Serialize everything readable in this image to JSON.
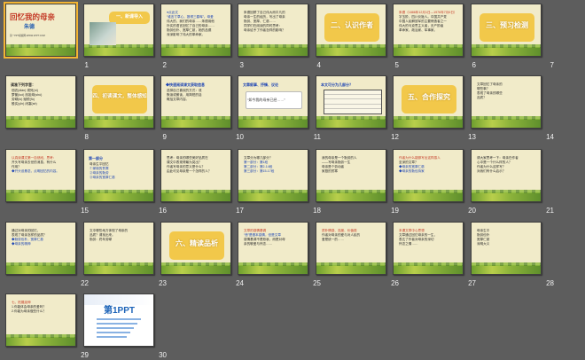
{
  "slides": [
    {
      "n": "1",
      "title": "回忆我的母亲",
      "sub": "朱德",
      "foot": "第一PPT模板网-WWW.1PPT.COM"
    },
    {
      "n": "2",
      "box": "一、新课导入"
    },
    {
      "n": "3",
      "lines": [
        "●点此文",
        "“谁言寸草心，报得三春晖”。母爱",
        "伟大的，我们的母亲……朱德用他",
        "朴实的语言回忆了自己的母亲……",
        "勤劳俭朴、宽厚仁慈，她的品德",
        "深深影响了伟大的革命家。"
      ]
    },
    {
      "n": "4",
      "lines": [
        "朱德回顾了自己伟大而平凡的",
        "母亲一生的经历，写出了母亲",
        "勤劳、宽厚、仁慈……",
        "同学们在阅读的同时思考：",
        "母亲给予了作者怎样的影响？"
      ]
    },
    {
      "n": "5",
      "box": "二、认识作者"
    },
    {
      "n": "6",
      "lines": [
        "朱德（1886年12月1日—1976年7月6日）",
        "字玉阶，四川仪陇人。中国共产党",
        "中国人民解放军的主要缔造者之一",
        "伟大的马克思主义者，无产阶级",
        "革命家、政治家、军事家。"
      ]
    },
    {
      "n": "7",
      "box": "三、预习检测"
    },
    {
      "n": "8",
      "title": "读准下列字音：",
      "lines": [
        "佃农(diàn)  溺死(nì)",
        "箩筐(luó)  庶祖母(shù)",
        "劳碌(lù)   赋税(fù)",
        "殷实(yīn)  闭塞(sè)"
      ]
    },
    {
      "n": "9",
      "box": "四、初读课文，整体感知"
    },
    {
      "n": "10",
      "head": "◆快速阅读课文获取信息",
      "lines": [
        "选择自己喜欢的方式：或",
        "默读或朗读，用简短的话",
        "概括文章内容。"
      ]
    },
    {
      "n": "11",
      "head": "文章叙事、抒情、议论",
      "q": "“如今我的母亲已经……”"
    },
    {
      "n": "12",
      "head": "本文可分为几部分？"
    },
    {
      "n": "13",
      "box": "五、合作探究"
    },
    {
      "n": "14",
      "lines": [
        "文章回忆了母亲的",
        "哪些事？",
        "表现了母亲的哪些",
        "品质？"
      ]
    },
    {
      "n": "15",
      "lines": [
        "认真读课文第一自然段，思考：",
        "开头写母亲去世的消息，有什么",
        "作用？",
        "◆开头设悬念，点明回忆的内容。"
      ]
    },
    {
      "n": "16",
      "head": "第一部分",
      "lines": [
        "母亲生平回忆",
        "①家境的贫寒",
        "②母亲的勤劳",
        "③母亲的宽厚仁慈"
      ]
    },
    {
      "n": "17",
      "lines": [
        "思考：母亲的哪些美好品质在",
        "课文中表现得最为突出？",
        "作者写母亲的意义是什么？",
        "由此可见母亲是一个怎样的人？"
      ]
    },
    {
      "n": "18",
      "lines": [
        "文章分为哪几部分？",
        "第一部分：第1段",
        "第二部分：第2-14段",
        "第三部分：第15-17段"
      ]
    },
    {
      "n": "19",
      "lines": [
        "我的母亲是一个勤劳的人",
        "——写母亲勤劳一生",
        "母亲是个劳动者",
        "家庭的贫寒"
      ]
    },
    {
      "n": "20",
      "lines": [
        "作者为什么能够写出这样感人",
        "至深的文章？",
        "◆母亲的宽厚仁慈",
        "◆母亲的勤俭持家"
      ]
    },
    {
      "n": "21",
      "lines": [
        "请大家思考一下：母亲在作者",
        "心中是一个什么样的人？",
        "作者为什么这样写？",
        "对我们有什么启示？"
      ]
    },
    {
      "n": "22",
      "lines": [
        "通过对母亲的回忆，",
        "表现了母亲怎样的品质？",
        "◆勤劳俭朴，宽厚仁慈",
        "◆母亲的精神"
      ]
    },
    {
      "n": "23",
      "lines": [
        "文中哪些地方体现了母亲的",
        "品质？请找出来。",
        "勤劳：终年劳碌"
      ]
    },
    {
      "n": "24",
      "box": "六、精读品析"
    },
    {
      "n": "25",
      "lines": [
        "文章的感情基调",
        "“悲”是基本感情，但是文章",
        "感情基调不是悲哀，而是对母",
        "亲的敬爱与怀念……"
      ]
    },
    {
      "n": "26",
      "lines": [
        "质朴情感、态度、价值观",
        "作者对母亲的爱与对人民的",
        "爱是统一的……"
      ]
    },
    {
      "n": "27",
      "lines": [
        "本课文章中心思想",
        "文章通过回忆母亲的一生，",
        "表达了作者对母亲的深切",
        "怀念之情……"
      ]
    },
    {
      "n": "28",
      "lines": [
        "母亲生平",
        "勤劳俭朴",
        "宽厚仁慈",
        "深明大义"
      ]
    },
    {
      "n": "29",
      "lines": [
        "七、拓展延伸",
        "1.你能体会母亲的爱吗？",
        "2.你能为母亲做些什么？"
      ]
    },
    {
      "n": "30",
      "logo": "第1PPT"
    }
  ]
}
